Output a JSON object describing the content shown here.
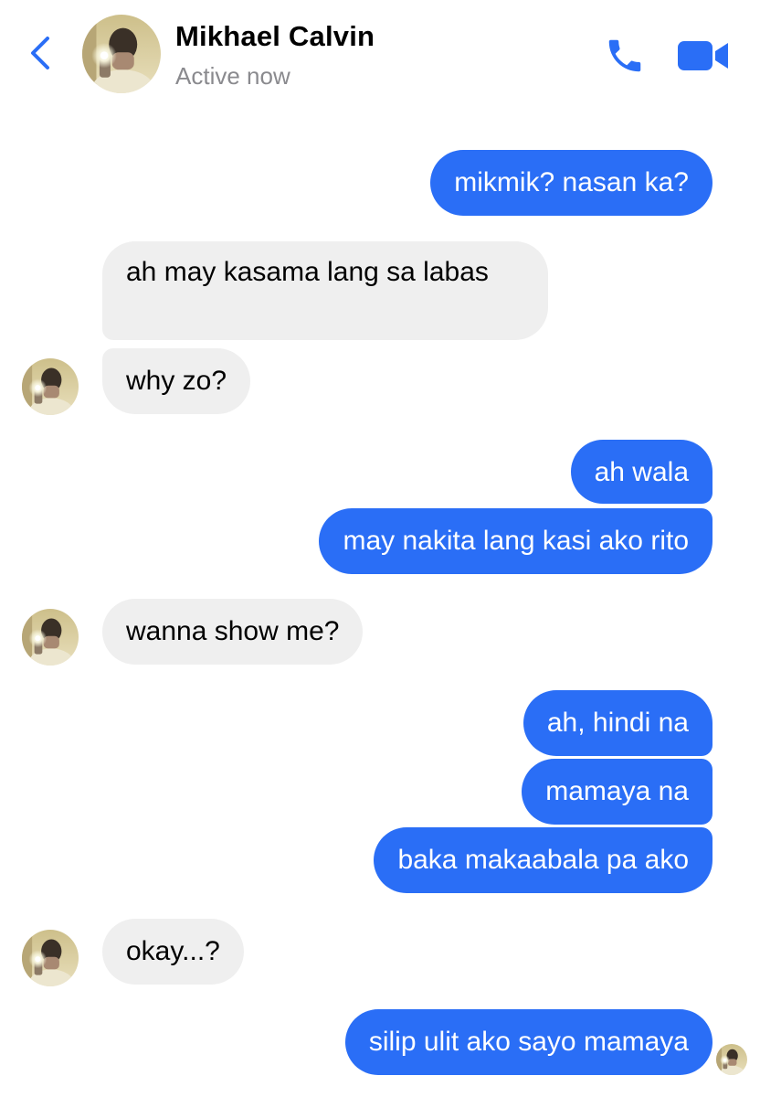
{
  "header": {
    "contact_name": "Mikhael Calvin",
    "status": "Active now"
  },
  "icons": {
    "back": "chevron-left-icon",
    "call": "phone-icon",
    "video": "video-camera-icon"
  },
  "colors": {
    "accent": "#2a6ef6",
    "sent_bubble": "#2a6ef6",
    "received_bubble": "#efefef",
    "status_text": "#8a8a8e"
  },
  "messages": [
    {
      "from": "me",
      "text": "mikmik? nasan ka?"
    },
    {
      "from": "contact",
      "text": "ah may kasama lang sa labas"
    },
    {
      "from": "contact",
      "text": "why zo?"
    },
    {
      "from": "me",
      "text": "ah wala"
    },
    {
      "from": "me",
      "text": "may nakita lang kasi ako rito"
    },
    {
      "from": "contact",
      "text": "wanna show me?"
    },
    {
      "from": "me",
      "text": "ah, hindi na"
    },
    {
      "from": "me",
      "text": "mamaya na"
    },
    {
      "from": "me",
      "text": "baka makaabala pa ako"
    },
    {
      "from": "contact",
      "text": "okay...?"
    },
    {
      "from": "me",
      "text": "silip ulit ako sayo mamaya"
    }
  ]
}
